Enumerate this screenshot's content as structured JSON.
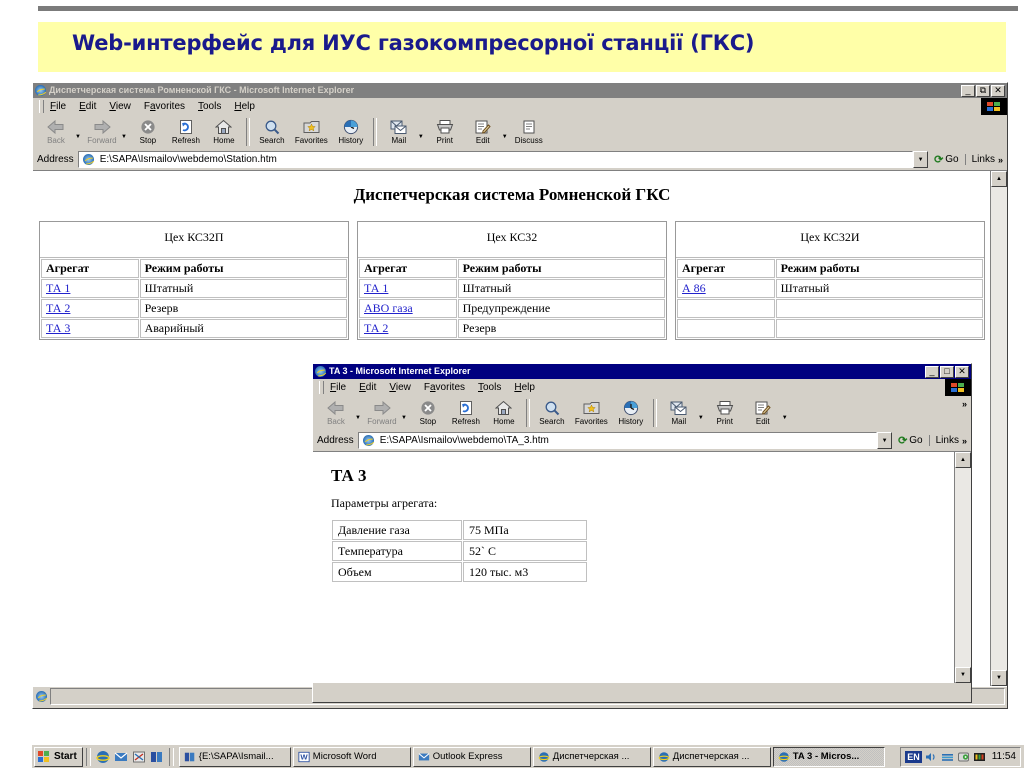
{
  "slide": {
    "title": "Web-интерфейс  для ИУС газокомпресорної станції (ГКС)",
    "band_color": "#ffffa8",
    "title_color": "#1a1a8c"
  },
  "main_window": {
    "title": "Диспетчерская система Ромненской ГКС - Microsoft Internet Explorer",
    "state": "inactive",
    "window_buttons": {
      "minimize": "_",
      "restore": "⧉",
      "close": "✕"
    },
    "menu": [
      {
        "label": "File",
        "accel": "F"
      },
      {
        "label": "Edit",
        "accel": "E"
      },
      {
        "label": "View",
        "accel": "V"
      },
      {
        "label": "Favorites",
        "accel": "a"
      },
      {
        "label": "Tools",
        "accel": "T"
      },
      {
        "label": "Help",
        "accel": "H"
      }
    ],
    "toolbar": [
      {
        "label": "Back",
        "icon": "back-arrow-icon",
        "disabled": true,
        "dropdown": true
      },
      {
        "label": "Forward",
        "icon": "forward-arrow-icon",
        "disabled": true,
        "dropdown": true
      },
      {
        "label": "Stop",
        "icon": "stop-icon",
        "disabled": false
      },
      {
        "label": "Refresh",
        "icon": "refresh-icon",
        "disabled": false
      },
      {
        "label": "Home",
        "icon": "home-icon",
        "disabled": false
      },
      {
        "label": "Search",
        "icon": "search-icon",
        "disabled": false
      },
      {
        "label": "Favorites",
        "icon": "favorites-star-icon",
        "disabled": false
      },
      {
        "label": "History",
        "icon": "history-clock-icon",
        "disabled": false
      },
      {
        "label": "Mail",
        "icon": "mail-icon",
        "disabled": false,
        "dropdown": true
      },
      {
        "label": "Print",
        "icon": "printer-icon",
        "disabled": false
      },
      {
        "label": "Edit",
        "icon": "edit-pencil-icon",
        "disabled": false,
        "dropdown": true
      },
      {
        "label": "Discuss",
        "icon": "discuss-icon",
        "disabled": false
      }
    ],
    "address": {
      "label": "Address",
      "value": "E:\\SAPA\\Ismailov\\webdemo\\Station.htm",
      "placeholder": "Address"
    },
    "go_label": "Go",
    "links_label": "Links",
    "page": {
      "heading": "Диспетчерская система Ромненской ГКС",
      "columns": [
        "Агрегат",
        "Режим работы"
      ],
      "workshops": [
        {
          "caption": "Цех КС32П",
          "rows": [
            {
              "unit": "ТА 1",
              "link": true,
              "mode": "Штатный",
              "mode_state": "normal"
            },
            {
              "unit": "ТА 2",
              "link": true,
              "mode": "Резерв",
              "mode_state": "normal"
            },
            {
              "unit": "ТА 3",
              "link": true,
              "mode": "Аварийный",
              "mode_state": "alarm"
            }
          ]
        },
        {
          "caption": "Цех КС32",
          "rows": [
            {
              "unit": "ТА 1",
              "link": true,
              "mode": "Штатный",
              "mode_state": "normal"
            },
            {
              "unit": "АВО газа",
              "link": true,
              "mode": "Предупреждение",
              "mode_state": "warn"
            },
            {
              "unit": "ТА 2",
              "link": true,
              "mode": "Резерв",
              "mode_state": "normal"
            }
          ]
        },
        {
          "caption": "Цех КС32И",
          "rows": [
            {
              "unit": "А 86",
              "link": true,
              "mode": "Штатный",
              "mode_state": "normal"
            },
            {
              "unit": "",
              "link": false,
              "mode": "",
              "mode_state": "normal"
            },
            {
              "unit": "",
              "link": false,
              "mode": "",
              "mode_state": "normal"
            }
          ]
        }
      ]
    },
    "mode_colors": {
      "normal": "#000000",
      "warn": "#ff8c1a",
      "alarm": "#ff2a2a",
      "link": "#2222cc"
    }
  },
  "child_window": {
    "title": "TA 3 - Microsoft Internet Explorer",
    "state": "active",
    "window_buttons": {
      "minimize": "_",
      "maximize": "□",
      "close": "✕"
    },
    "menu": [
      {
        "label": "File",
        "accel": "F"
      },
      {
        "label": "Edit",
        "accel": "E"
      },
      {
        "label": "View",
        "accel": "V"
      },
      {
        "label": "Favorites",
        "accel": "a"
      },
      {
        "label": "Tools",
        "accel": "T"
      },
      {
        "label": "Help",
        "accel": "H"
      }
    ],
    "toolbar": [
      {
        "label": "Back",
        "icon": "back-arrow-icon",
        "disabled": true,
        "dropdown": true
      },
      {
        "label": "Forward",
        "icon": "forward-arrow-icon",
        "disabled": true,
        "dropdown": true
      },
      {
        "label": "Stop",
        "icon": "stop-icon",
        "disabled": false
      },
      {
        "label": "Refresh",
        "icon": "refresh-icon",
        "disabled": false
      },
      {
        "label": "Home",
        "icon": "home-icon",
        "disabled": false
      },
      {
        "label": "Search",
        "icon": "search-icon",
        "disabled": false
      },
      {
        "label": "Favorites",
        "icon": "favorites-star-icon",
        "disabled": false
      },
      {
        "label": "History",
        "icon": "history-clock-icon",
        "disabled": false
      },
      {
        "label": "Mail",
        "icon": "mail-icon",
        "disabled": false,
        "dropdown": true
      },
      {
        "label": "Print",
        "icon": "printer-icon",
        "disabled": false
      },
      {
        "label": "Edit",
        "icon": "edit-pencil-icon",
        "disabled": false,
        "dropdown": true
      }
    ],
    "toolbar_overflow": "»",
    "address": {
      "label": "Address",
      "value": "E:\\SAPA\\Ismailov\\webdemo\\TA_3.htm",
      "placeholder": "Address"
    },
    "go_label": "Go",
    "links_label": "Links",
    "page": {
      "heading": "ТА 3",
      "subtitle": "Параметры агрегата:",
      "parameters": [
        {
          "name": "Давление газа",
          "value": "75 МПа"
        },
        {
          "name": "Температура",
          "value": "52` С"
        },
        {
          "name": "Объем",
          "value": "120 тыс. м3"
        }
      ]
    }
  },
  "taskbar": {
    "start_label": "Start",
    "quick_launch": [
      {
        "name": "internet-explorer-icon"
      },
      {
        "name": "outlook-express-icon"
      },
      {
        "name": "show-desktop-icon"
      },
      {
        "name": "explorer-folder-icon"
      }
    ],
    "tasks": [
      {
        "label": "{E:\\SAPA\\Ismail...",
        "icon": "explorer-folder-icon",
        "active": false
      },
      {
        "label": "Microsoft Word",
        "icon": "word-icon",
        "active": false
      },
      {
        "label": "Outlook Express",
        "icon": "outlook-express-icon",
        "active": false
      },
      {
        "label": "Диспетчерская ...",
        "icon": "ie-icon",
        "active": false
      },
      {
        "label": "Диспетчерская ...",
        "icon": "ie-icon",
        "active": false
      },
      {
        "label": "TA 3 - Micros...",
        "icon": "ie-icon",
        "active": true
      }
    ],
    "tray": {
      "language": "EN",
      "icons": [
        "volume-icon",
        "network-icon",
        "media-icon",
        "antivirus-icon"
      ],
      "clock": "11:54"
    }
  }
}
